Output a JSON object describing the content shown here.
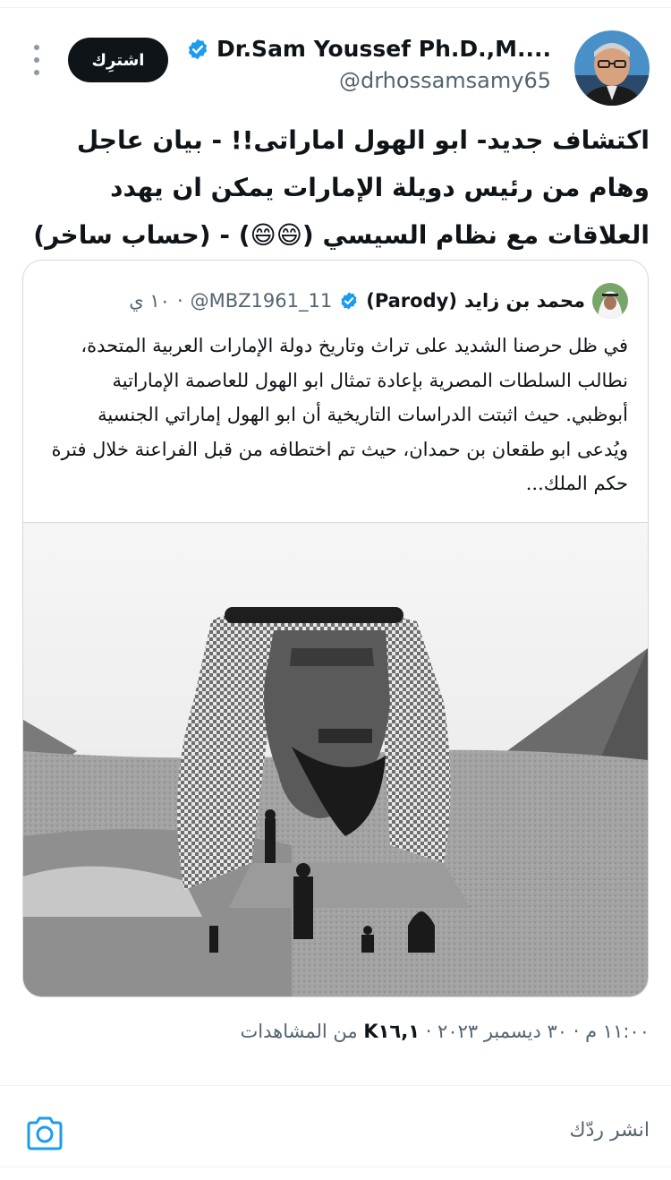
{
  "author": {
    "display_name": "Dr.Sam Youssef Ph.D.,M....",
    "handle": "@drhossamsamy65",
    "verified_icon": "verified-badge-icon"
  },
  "subscribe_label": "اشترِك",
  "more_icon": "more-vertical-icon",
  "tweet": {
    "text": "اكتشاف جديد- ابو الهول اماراتى!! - بيان عاجل وهام من رئيس دويلة الإمارات يمكن ان يهدد العلاقات مع نظام السيسي (😄😄) - (حساب ساخر)"
  },
  "quote": {
    "name": "محمد بن زايد",
    "tag": "(Parody)",
    "handle": "@MBZ1961_11",
    "separator": "·",
    "time": "١٠ ي",
    "text": "في ظل حرصنا الشديد على تراث وتاريخ دولة الإمارات العربية المتحدة، نطالب السلطات المصرية بإعادة تمثال ابو الهول للعاصمة الإماراتية أبوظبي. حيث اثبتت الدراسات التاريخية أن ابو الهول إماراتي الجنسية ويُدعى ابو طقعان بن حمدان، حيث تم اختطافه من قبل الفراعنة خلال فترة حكم الملك..."
  },
  "meta": {
    "time_date": "١١:٠٠ م · ٣٠ ديسمبر ٢٠٢٣ · ",
    "views_count": "K١٦,١",
    "views_label": " من المشاهدات"
  },
  "reply": {
    "placeholder": "انشر ردّك",
    "camera_icon": "camera-icon"
  },
  "colors": {
    "accent": "#1d9bf0",
    "text_primary": "#0f1419",
    "text_secondary": "#536471",
    "border": "#cfd9de",
    "button_bg": "#0f1419"
  }
}
